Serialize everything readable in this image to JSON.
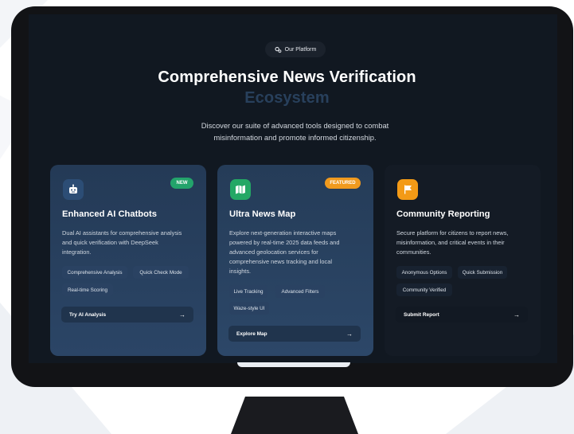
{
  "platform_pill": {
    "label": "Our Platform"
  },
  "hero": {
    "title_line1": "Comprehensive News Verification",
    "title_line2": "Ecosystem",
    "subtitle_line1": "Discover our suite of advanced tools designed to combat",
    "subtitle_line2": "misinformation and promote informed citizenship."
  },
  "cards": [
    {
      "icon": "robot-icon",
      "icon_color": "#2c4d75",
      "badge": "NEW",
      "badge_color": "#23a36b",
      "title": "Enhanced AI Chatbots",
      "desc_lines": [
        "Dual AI assistants for comprehensive analysis",
        "and quick verification with DeepSeek",
        "integration."
      ],
      "tags": [
        "Comprehensive Analysis",
        "Quick Check Mode",
        "Real-time Scoring"
      ],
      "action": "Try AI Analysis"
    },
    {
      "icon": "map-icon",
      "icon_color": "#24a865",
      "badge": "FEATURED",
      "badge_color": "#f09a1e",
      "title": "Ultra News Map",
      "desc_lines": [
        "Explore next-generation interactive maps",
        "powered by real-time 2025 data feeds and",
        "advanced geolocation services for",
        "comprehensive news tracking and local",
        "insights."
      ],
      "tags": [
        "Live Tracking",
        "Advanced Filters",
        "Waze-style UI"
      ],
      "action": "Explore Map"
    },
    {
      "icon": "flag-icon",
      "icon_color": "#f39a16",
      "title": "Community Reporting",
      "desc_lines": [
        "Secure platform for citizens to report news,",
        "misinformation, and critical events in their",
        "communities."
      ],
      "tags": [
        "Anonymous Options",
        "Quick Submission",
        "Community Verified"
      ],
      "action": "Submit Report"
    }
  ]
}
